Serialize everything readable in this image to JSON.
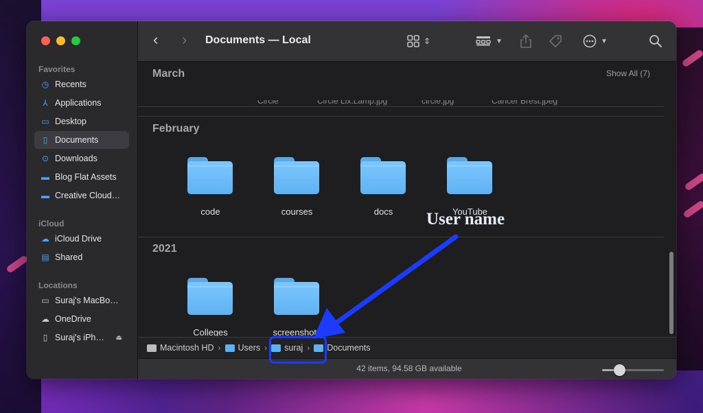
{
  "window": {
    "title": "Documents — Local"
  },
  "sidebar": {
    "favorites": {
      "label": "Favorites",
      "items": [
        {
          "label": "Recents",
          "icon": "clock-icon"
        },
        {
          "label": "Applications",
          "icon": "applications-icon"
        },
        {
          "label": "Desktop",
          "icon": "desktop-icon"
        },
        {
          "label": "Documents",
          "icon": "document-icon",
          "active": true
        },
        {
          "label": "Downloads",
          "icon": "download-icon"
        },
        {
          "label": "Blog Flat Assets",
          "icon": "folder-icon"
        },
        {
          "label": "Creative Cloud…",
          "icon": "folder-icon"
        }
      ]
    },
    "icloud": {
      "label": "iCloud",
      "items": [
        {
          "label": "iCloud Drive",
          "icon": "cloud-icon"
        },
        {
          "label": "Shared",
          "icon": "shared-folder-icon"
        }
      ]
    },
    "locations": {
      "label": "Locations",
      "items": [
        {
          "label": "Suraj's MacBo…",
          "icon": "laptop-icon"
        },
        {
          "label": "OneDrive",
          "icon": "cloud-icon"
        },
        {
          "label": "Suraj's iPh…",
          "icon": "phone-icon"
        }
      ]
    }
  },
  "toolbar": {
    "back": "‹",
    "forward": "›"
  },
  "content": {
    "groups": [
      {
        "title": "March",
        "show_all": "Show All (7)",
        "clipped": [
          "Circle",
          "Circle Lix.Lamp.jpg",
          "circle.jpg",
          "Cancer Brest.jpeg"
        ]
      },
      {
        "title": "February",
        "folders": [
          "code",
          "courses",
          "docs",
          "YouTube"
        ]
      },
      {
        "title": "2021",
        "folders": [
          "Colleges",
          "screenshots"
        ]
      }
    ]
  },
  "pathbar": {
    "segments": [
      "Macintosh HD",
      "Users",
      "suraj",
      "Documents"
    ]
  },
  "status": {
    "text": "42 items, 94.58 GB available"
  },
  "annotation": {
    "text": "User name",
    "color": "#1b3cff"
  },
  "colors": {
    "folder": "#6bbcf8",
    "accent": "#4aa3ff",
    "window_bg": "#1e1e20",
    "sidebar_bg": "#2a2a2d"
  }
}
